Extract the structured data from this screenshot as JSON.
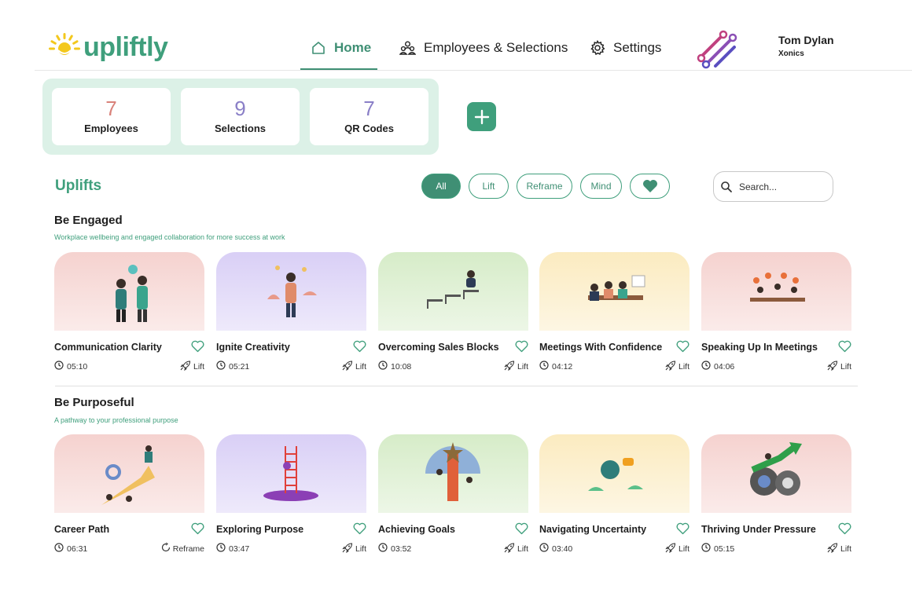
{
  "brand": {
    "name": "upliftly",
    "color": "#3f9f7c"
  },
  "nav": [
    {
      "label": "Home",
      "icon": "home-icon",
      "active": true
    },
    {
      "label": "Employees & Selections",
      "icon": "people-icon",
      "active": false
    },
    {
      "label": "Settings",
      "icon": "gear-icon",
      "active": false
    }
  ],
  "user": {
    "name": "Tom Dylan",
    "org": "Xonics"
  },
  "stats": [
    {
      "value": "7",
      "label": "Employees",
      "color": "#d9827a"
    },
    {
      "value": "9",
      "label": "Selections",
      "color": "#8a7fc7"
    },
    {
      "value": "7",
      "label": "QR Codes",
      "color": "#8a7fc7"
    }
  ],
  "uplifts": {
    "title": "Uplifts",
    "filters": [
      "All",
      "Lift",
      "Reframe",
      "Mind"
    ],
    "favorites_icon": "heart-icon",
    "search_placeholder": "Search..."
  },
  "categories": [
    {
      "title": "Be Engaged",
      "subtitle": "Workplace wellbeing and engaged collaboration for more success at work",
      "cards": [
        {
          "title": "Communication Clarity",
          "time": "05:10",
          "type": "Lift",
          "bg": "#f5d2cf"
        },
        {
          "title": "Ignite Creativity",
          "time": "05:21",
          "type": "Lift",
          "bg": "#d9cff6"
        },
        {
          "title": "Overcoming Sales Blocks",
          "time": "10:08",
          "type": "Lift",
          "bg": "#d6ecc8"
        },
        {
          "title": "Meetings With Confidence",
          "time": "04:12",
          "type": "Lift",
          "bg": "#fbebc0"
        },
        {
          "title": "Speaking Up In Meetings",
          "time": "04:06",
          "type": "Lift",
          "bg": "#f5d2cf"
        }
      ]
    },
    {
      "title": "Be Purposeful",
      "subtitle": "A pathway to your professional purpose",
      "cards": [
        {
          "title": "Career Path",
          "time": "06:31",
          "type": "Reframe",
          "bg": "#f5d2cf"
        },
        {
          "title": "Exploring Purpose",
          "time": "03:47",
          "type": "Lift",
          "bg": "#d9cff6"
        },
        {
          "title": "Achieving Goals",
          "time": "03:52",
          "type": "Lift",
          "bg": "#d6ecc8"
        },
        {
          "title": "Navigating Uncertainty",
          "time": "03:40",
          "type": "Lift",
          "bg": "#fbebc0"
        },
        {
          "title": "Thriving Under Pressure",
          "time": "05:15",
          "type": "Lift",
          "bg": "#f5d2cf"
        }
      ]
    }
  ]
}
